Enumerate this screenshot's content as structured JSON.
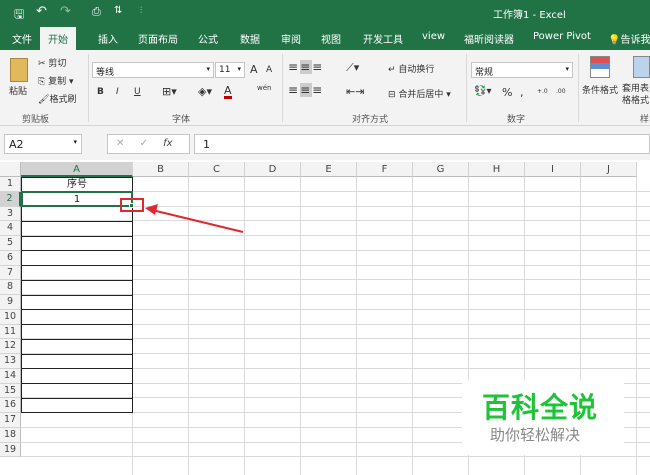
{
  "title": "工作簿1  -  Excel",
  "qat": {
    "save": "save-icon",
    "undo": "undo-icon",
    "redo": "redo-icon",
    "preview": "print-preview-icon",
    "sort": "sort-icon",
    "customize": "⫶"
  },
  "tabs": [
    "文件",
    "开始",
    "插入",
    "页面布局",
    "公式",
    "数据",
    "审阅",
    "视图",
    "开发工具",
    "view",
    "福昕阅读器",
    "Power Pivot"
  ],
  "tell_me": "告诉我",
  "ribbon": {
    "clipboard": {
      "paste": "粘贴",
      "cut": "剪切",
      "copy": "复制",
      "format_painter": "格式刷",
      "group": "剪贴板"
    },
    "font": {
      "name": "等线",
      "size": "11",
      "bold": "B",
      "italic": "I",
      "underline": "U",
      "grow": "A",
      "shrink": "A",
      "font_color": "A",
      "phonetic": "wén",
      "group": "字体"
    },
    "alignment": {
      "wrap": "自动换行",
      "merge": "合并后居中",
      "group": "对齐方式"
    },
    "number": {
      "format": "常规",
      "percent": "%",
      "comma": ",",
      "inc": "+.0",
      "dec": ".00",
      "group": "数字"
    },
    "styles": {
      "conditional": "条件格式",
      "table": "套用表格格式",
      "group": "样"
    }
  },
  "formula_bar": {
    "name_box": "A2",
    "cancel": "✕",
    "enter": "✓",
    "fx": "fx",
    "value": "1"
  },
  "columns": [
    "A",
    "B",
    "C",
    "D",
    "E",
    "F",
    "G",
    "H",
    "I",
    "J"
  ],
  "rows": [
    "1",
    "2",
    "3",
    "4",
    "5",
    "6",
    "7",
    "8",
    "9",
    "10",
    "11",
    "12",
    "13",
    "14",
    "15",
    "16",
    "17",
    "18",
    "19"
  ],
  "cells": {
    "A1": "序号",
    "A2": "1"
  },
  "watermark": {
    "title": "百科全说",
    "subtitle": "助你轻松解决"
  },
  "colors": {
    "excel_green": "#217346",
    "annotation_red": "#e0282e",
    "watermark_green": "#1ec337"
  }
}
